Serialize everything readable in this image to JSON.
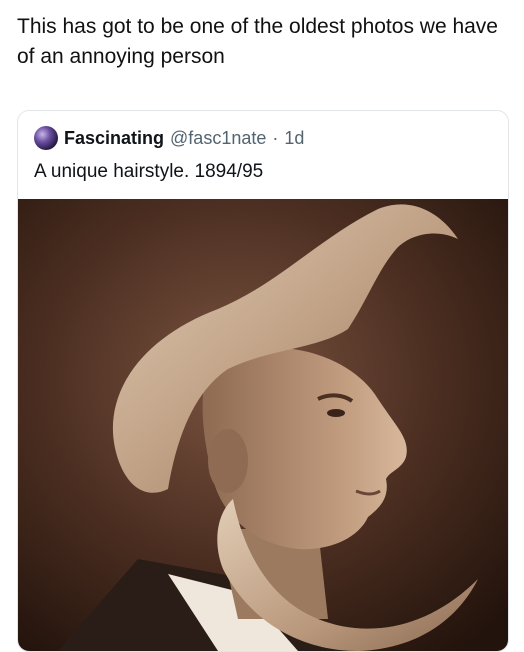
{
  "caption": "This has got to be one of the oldest photos we have of an annoying person",
  "tweet": {
    "display_name": "Fascinating",
    "handle": "@fasc1nate",
    "separator": "·",
    "age": "1d",
    "text": "A unique hairstyle. 1894/95",
    "avatar_icon": "avatar-image",
    "photo_description_icon": "sepia-portrait-photo"
  },
  "colors": {
    "sepia_dark": "#2b1a12",
    "sepia_mid": "#5a3d2c",
    "hair": "#cdb49a",
    "skin": "#b08a6d"
  }
}
